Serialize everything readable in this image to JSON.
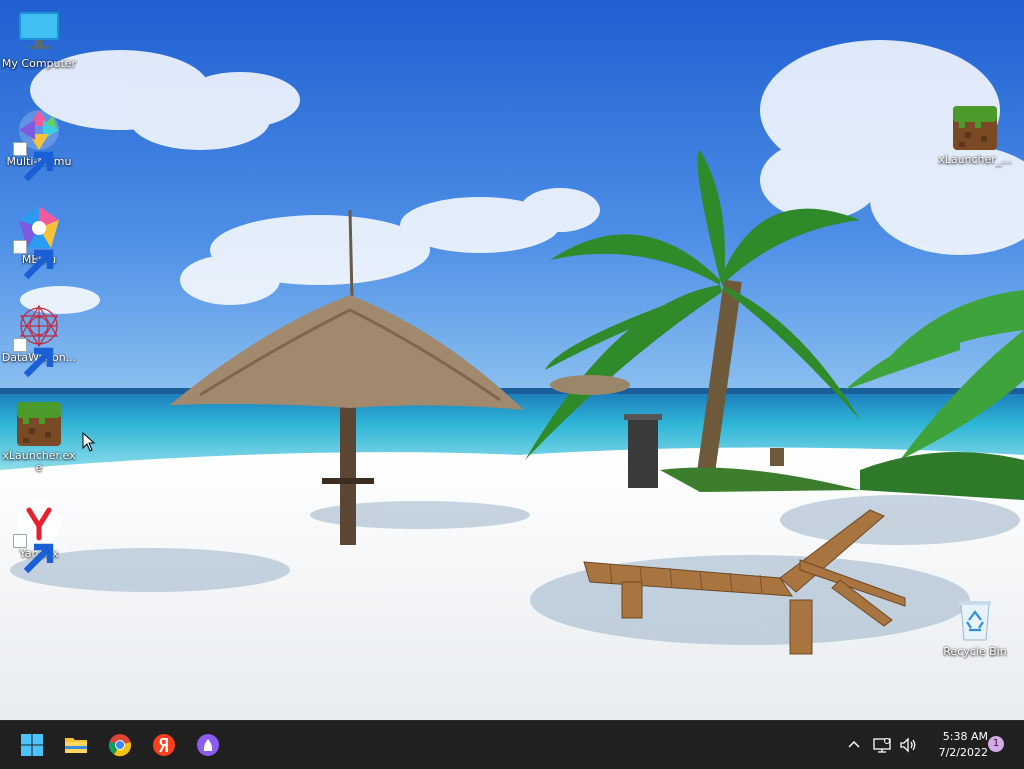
{
  "desktop": {
    "icons": [
      {
        "label": "My Computer"
      },
      {
        "label": "Multi-MEmu"
      },
      {
        "label": "MEmu"
      },
      {
        "label": "DataWagon..."
      },
      {
        "label": "xLauncher.exe"
      },
      {
        "label": "Yandex"
      },
      {
        "label": "xLauncher_..."
      },
      {
        "label": "Recycle Bin"
      }
    ]
  },
  "taskbar": {
    "apps": [
      {
        "icon": "windows-start-icon"
      },
      {
        "icon": "file-explorer-icon"
      },
      {
        "icon": "chrome-icon"
      },
      {
        "icon": "yandex-browser-icon"
      },
      {
        "icon": "alice-assistant-icon"
      }
    ],
    "tray": {
      "time": "5:38 AM",
      "date": "7/2/2022",
      "notification_count": "1"
    }
  },
  "colors": {
    "taskbar_bg": "#202020",
    "sky": "#3f7fd9",
    "sea": "#2fb5d6",
    "sand": "#f2f4f6"
  }
}
